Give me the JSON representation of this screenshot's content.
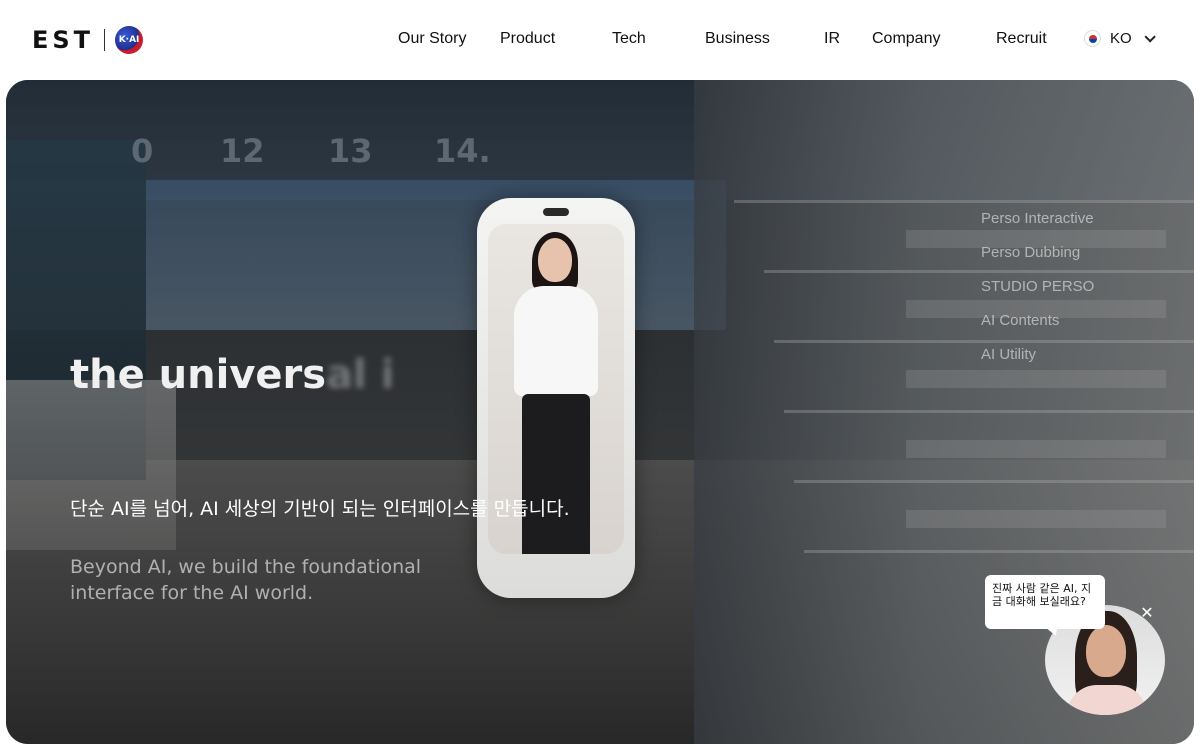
{
  "header": {
    "logo_text": "EST",
    "badge_text": "K·AI",
    "nav": [
      {
        "label": "Our Story"
      },
      {
        "label": "Product"
      },
      {
        "label": "Tech"
      },
      {
        "label": "Business"
      },
      {
        "label": "IR"
      },
      {
        "label": "Company"
      },
      {
        "label": "Recruit"
      }
    ],
    "language": "KO"
  },
  "hero": {
    "aisle_numbers": [
      "0",
      "12",
      "13",
      "14."
    ],
    "headline_visible": "the univers",
    "headline_faded": "al i",
    "description_ko": "단순 AI를 넘어, AI 세상의 기반이 되는 인터페이스를 만듭니다.",
    "description_en": "Beyond AI, we build the foundational interface for the AI world.",
    "products": [
      {
        "label": "Perso Interactive"
      },
      {
        "label": "Perso Dubbing"
      },
      {
        "label": "STUDIO PERSO"
      },
      {
        "label": "AI Contents"
      },
      {
        "label": "AI Utility"
      }
    ]
  },
  "chat": {
    "bubble_text": "진짜 사람 같은 AI, 지금 대화해 보실래요?",
    "close_symbol": "✕"
  }
}
